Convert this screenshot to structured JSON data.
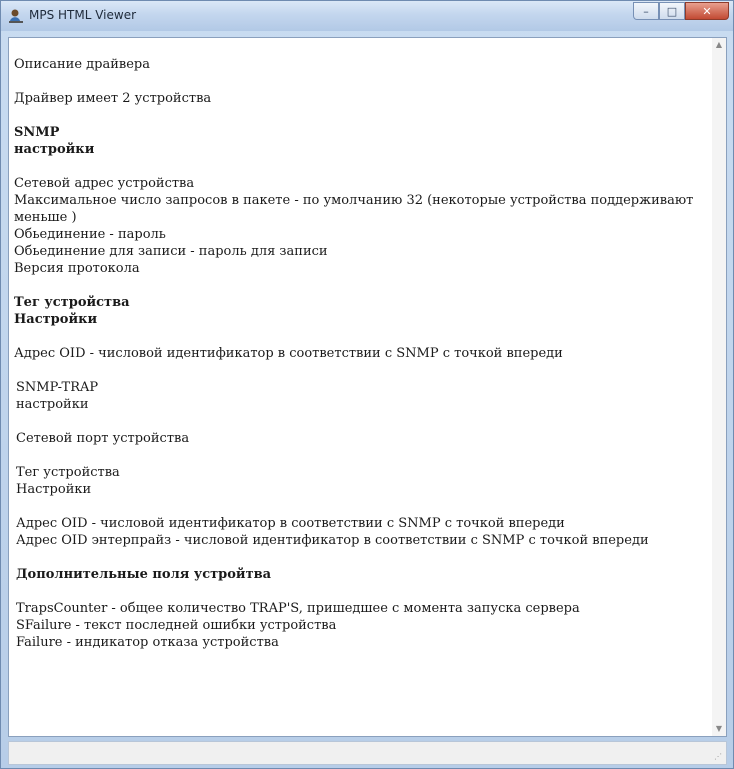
{
  "window": {
    "title": "MPS HTML Viewer",
    "minimize": "–",
    "maximize": "□",
    "close": "✕"
  },
  "doc": {
    "p1": "Описание драйвера",
    "p2": "Драйвер имеет 2 устройства",
    "h1a": "SNMP",
    "h1b": "настройки",
    "l1": "Сетевой адрес устройства",
    "l2": "Максимальное число запросов в пакете - по умолчанию 32 (некоторые устройства поддерживают меньше )",
    "l3": "Обьединение - пароль",
    "l4": "Обьединение для записи - пароль для записи",
    "l5": "Версия протокола",
    "h2a": "Тег устройства",
    "h2b": "Настройки",
    "p3": "Адрес OID - числовой идентификатор в соответствии с SNMP с точкой впереди",
    "s1a": "SNMP-TRAP",
    "s1b": "настройки",
    "p4": "Сетевой порт устройства",
    "s2a": "Тег устройства",
    "s2b": "Настройки",
    "p5a": "Адрес OID - числовой идентификатор в соответствии с SNMP с точкой впереди",
    "p5b": "Адрес OID энтерпрайз - числовой идентификатор в соответствии с SNMP с точкой впереди",
    "h3": "Дополнительные поля устройтва",
    "f1": "TrapsCounter - общее количество TRAP'S, пришедшее с момента запуска сервера",
    "f2": "SFailure - текст последней ошибки устройства",
    "f3": "Failure - индикатор отказа устройства"
  },
  "scrollbar": {
    "up": "▲",
    "down": "▼"
  },
  "statusbar": {
    "grip": "⋰"
  }
}
